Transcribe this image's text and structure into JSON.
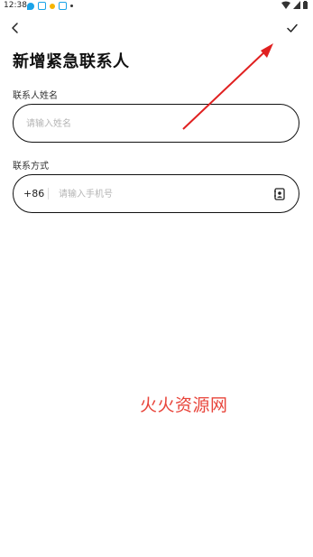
{
  "status_bar": {
    "time": "12:38"
  },
  "page": {
    "title": "新增紧急联系人"
  },
  "name_field": {
    "label": "联系人姓名",
    "placeholder": "请输入姓名",
    "value": ""
  },
  "contact_field": {
    "label": "联系方式",
    "country_code": "+86",
    "placeholder": "请输入手机号",
    "value": ""
  },
  "watermark": {
    "text": "火火资源网"
  },
  "colors": {
    "annotation": "#e02020",
    "watermark": "#e8443a",
    "border": "#111111",
    "placeholder": "#b5b5b5"
  }
}
